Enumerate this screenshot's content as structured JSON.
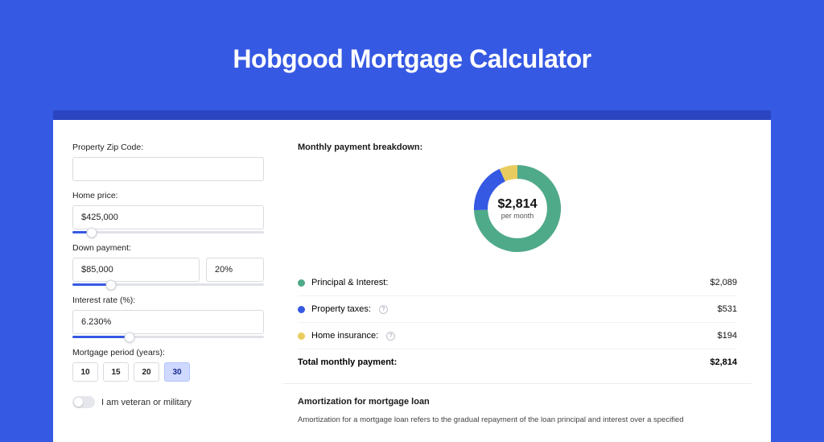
{
  "hero": {
    "title": "Hobgood Mortgage Calculator"
  },
  "form": {
    "zip_label": "Property Zip Code:",
    "zip_value": "",
    "home_price_label": "Home price:",
    "home_price_value": "$425,000",
    "home_price_slider_pct": 10,
    "down_payment_label": "Down payment:",
    "down_payment_value": "$85,000",
    "down_payment_pct_value": "20%",
    "down_payment_slider_pct": 20,
    "interest_label": "Interest rate (%):",
    "interest_value": "6.230%",
    "interest_slider_pct": 30,
    "period_label": "Mortgage period (years):",
    "periods": [
      "10",
      "15",
      "20",
      "30"
    ],
    "period_selected_index": 3,
    "veteran_label": "I am veteran or military",
    "veteran_on": false
  },
  "breakdown": {
    "title": "Monthly payment breakdown:",
    "center_amount": "$2,814",
    "center_sub": "per month",
    "rows": [
      {
        "label": "Principal & Interest:",
        "value": "$2,089",
        "color": "green",
        "info": false
      },
      {
        "label": "Property taxes:",
        "value": "$531",
        "color": "blue",
        "info": true
      },
      {
        "label": "Home insurance:",
        "value": "$194",
        "color": "yellow",
        "info": true
      }
    ],
    "total_label": "Total monthly payment:",
    "total_value": "$2,814"
  },
  "amort": {
    "title": "Amortization for mortgage loan",
    "text": "Amortization for a mortgage loan refers to the gradual repayment of the loan principal and interest over a specified"
  },
  "chart_data": {
    "type": "pie",
    "title": "Monthly payment breakdown",
    "series": [
      {
        "name": "Principal & Interest",
        "value": 2089,
        "color": "#4faa89"
      },
      {
        "name": "Property taxes",
        "value": 531,
        "color": "#3659e3"
      },
      {
        "name": "Home insurance",
        "value": 194,
        "color": "#e9cc5f"
      }
    ],
    "total": 2814,
    "center_label": "$2,814 per month",
    "donut": true
  }
}
